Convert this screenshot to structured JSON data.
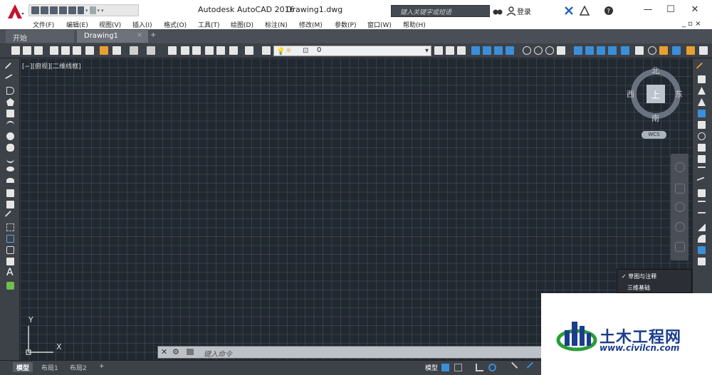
{
  "title": {
    "app": "Autodesk AutoCAD 2016",
    "file": "Drawing1.dwg",
    "search_placeholder": "键入关键字或短语",
    "login": "登录"
  },
  "menu": [
    "文件(F)",
    "编辑(E)",
    "视图(V)",
    "插入(I)",
    "格式(O)",
    "工具(T)",
    "绘图(D)",
    "标注(N)",
    "修改(M)",
    "参数(P)",
    "窗口(W)",
    "帮助(H)"
  ],
  "tabs": {
    "start": "开始",
    "drawing": "Drawing1",
    "close": "×",
    "add": "+"
  },
  "layer": {
    "current": "0"
  },
  "viewport": {
    "label": "[−][俯视][二维线框]"
  },
  "viewcube": {
    "north": "北",
    "south": "南",
    "east": "东",
    "west": "西",
    "top": "上",
    "wcs": "WCS"
  },
  "ucs": {
    "x": "X",
    "y": "Y"
  },
  "workspace_menu": {
    "items": [
      {
        "check": "✓",
        "label": "草图与注释"
      },
      {
        "check": "",
        "label": "三维基础"
      }
    ]
  },
  "command": {
    "placeholder": "键入命令"
  },
  "layout_tabs": [
    "模型",
    "布局1",
    "布局2",
    "+"
  ],
  "status": {
    "model": "模型"
  },
  "watermark": {
    "title": "土木工程网",
    "url": "www.civilcn.com"
  }
}
